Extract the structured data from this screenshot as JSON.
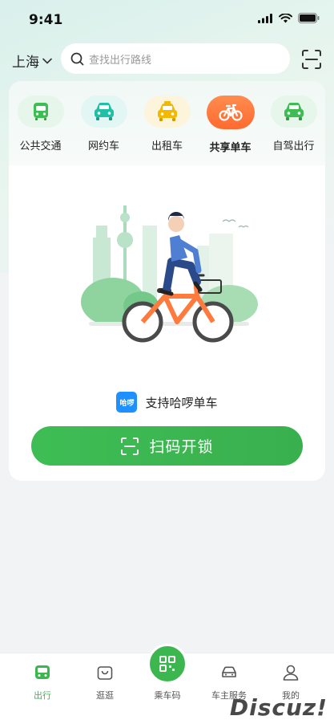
{
  "status_bar": {
    "time": "9:41"
  },
  "header": {
    "city": "上海",
    "search_placeholder": "查找出行路线"
  },
  "tabs": [
    {
      "label": "公共交通",
      "icon": "bus-icon",
      "active": false
    },
    {
      "label": "网约车",
      "icon": "car-icon",
      "active": false
    },
    {
      "label": "出租车",
      "icon": "taxi-icon",
      "active": false
    },
    {
      "label": "共享单车",
      "icon": "bike-icon",
      "active": true
    },
    {
      "label": "自驾出行",
      "icon": "self-drive-icon",
      "active": false
    }
  ],
  "bike_panel": {
    "brand_badge": "哈啰",
    "support_text": "支持哈啰单车",
    "unlock_label": "扫码开锁"
  },
  "bottom_nav": [
    {
      "label": "出行",
      "icon": "travel-icon",
      "active": true
    },
    {
      "label": "逛逛",
      "icon": "shopping-bag-icon",
      "active": false
    },
    {
      "label": "乘车码",
      "icon": "qr-code-icon",
      "active": false
    },
    {
      "label": "车主服务",
      "icon": "car-owner-icon",
      "active": false
    },
    {
      "label": "我的",
      "icon": "profile-icon",
      "active": false
    }
  ],
  "watermark": "Discuz!",
  "colors": {
    "accent_green": "#3cb64f",
    "bike_orange": "#ff7a3d",
    "taxi_yellow": "#f5b800",
    "teal": "#1fbfa8"
  }
}
